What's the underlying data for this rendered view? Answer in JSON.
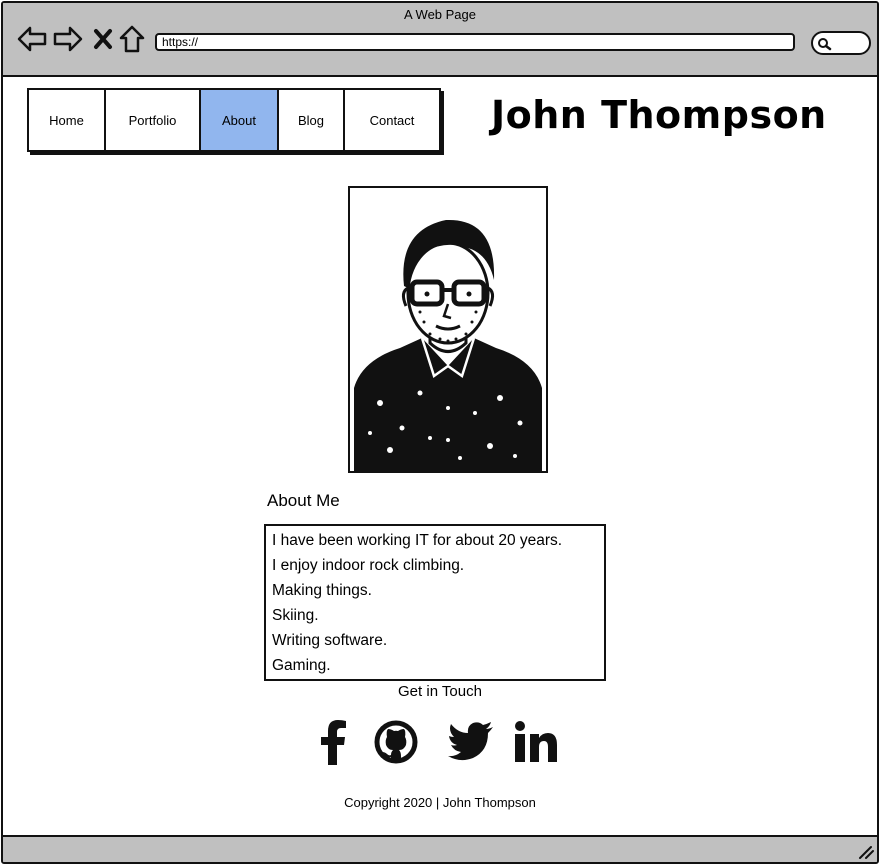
{
  "window": {
    "title": "A Web Page"
  },
  "browser": {
    "url": "https://"
  },
  "nav": {
    "items": [
      {
        "label": "Home"
      },
      {
        "label": "Portfolio"
      },
      {
        "label": "About"
      },
      {
        "label": "Blog"
      },
      {
        "label": "Contact"
      }
    ],
    "active": "About"
  },
  "site": {
    "title": "John Thompson"
  },
  "about": {
    "heading": "About Me",
    "lines": [
      "I have been working IT for about 20 years.",
      "I enjoy indoor rock climbing.",
      "Making things.",
      "Skiing.",
      "Writing software.",
      "Gaming."
    ]
  },
  "contact": {
    "heading": "Get in Touch",
    "social_icons": [
      "facebook-icon",
      "github-icon",
      "twitter-icon",
      "linkedin-icon"
    ]
  },
  "footer": {
    "copyright": "Copyright 2020 | John Thompson"
  },
  "colors": {
    "chrome": "#c0c0c0",
    "active_tab": "#91b6ee",
    "ink": "#111111"
  }
}
